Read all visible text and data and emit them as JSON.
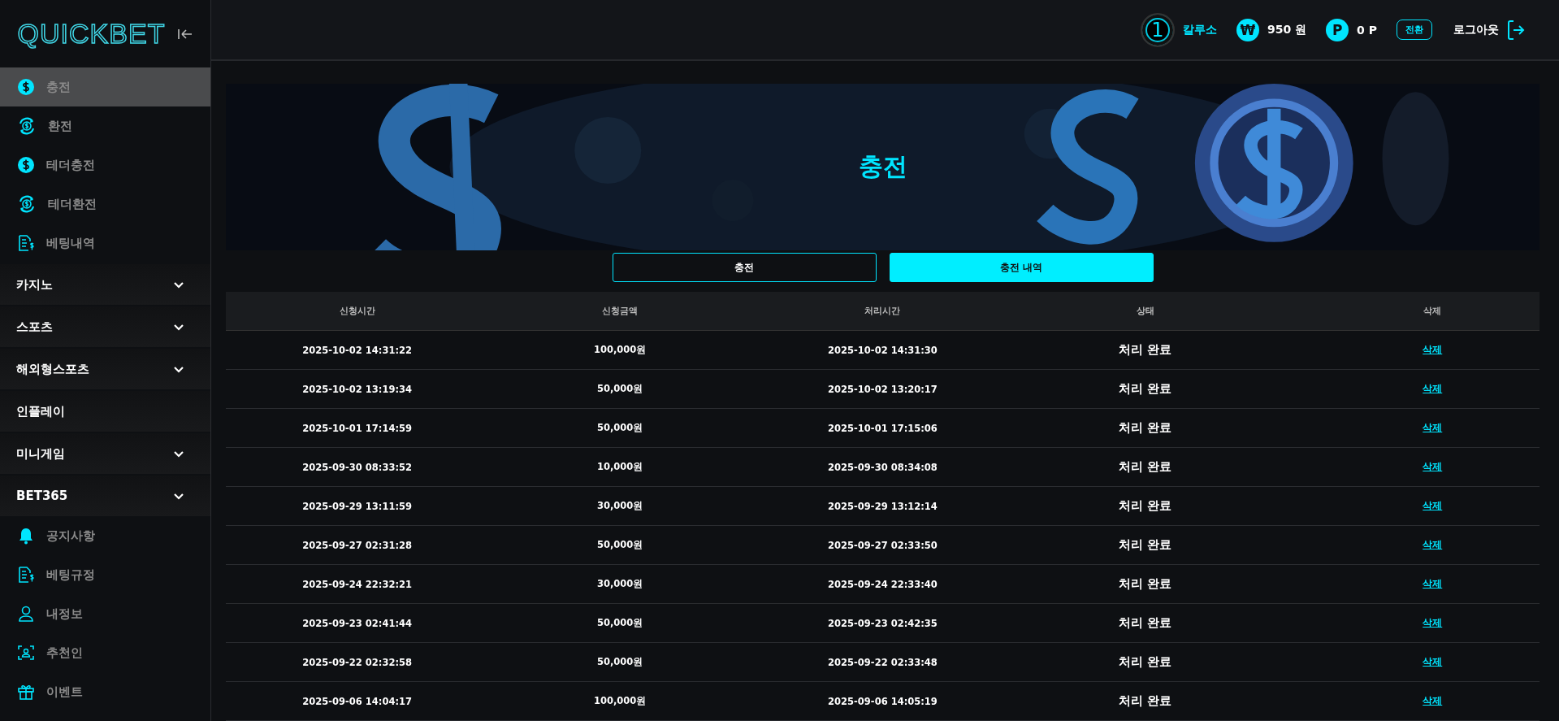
{
  "logo": "QUICKBET",
  "sidebar": {
    "top_items": [
      {
        "label": "충전",
        "kind": "coin",
        "selected": true
      },
      {
        "label": "환전",
        "kind": "exchange",
        "selected": false
      },
      {
        "label": "테더충전",
        "kind": "coin",
        "selected": false
      },
      {
        "label": "테더환전",
        "kind": "exchange",
        "selected": false
      },
      {
        "label": "베팅내역",
        "kind": "receipt",
        "selected": false
      }
    ],
    "groups": [
      {
        "label": "카지노",
        "expanded": false
      },
      {
        "label": "스포츠",
        "expanded": false
      },
      {
        "label": "해외형스포츠",
        "expanded": false
      },
      {
        "label": "인플레이"
      },
      {
        "label": "미니게임",
        "expanded": false
      },
      {
        "label": "BET365",
        "expanded": false
      }
    ],
    "bottom_items": [
      {
        "label": "공지사항",
        "kind": "bell",
        "selected": false
      },
      {
        "label": "베팅규정",
        "kind": "receipt",
        "selected": false
      },
      {
        "label": "내정보",
        "kind": "user",
        "selected": false
      },
      {
        "label": "추천인",
        "kind": "scan-user",
        "selected": false
      },
      {
        "label": "이벤트",
        "kind": "gift",
        "selected": false
      }
    ]
  },
  "header": {
    "level": "1",
    "username": "칼루소",
    "money_symbol": "₩",
    "money": "950 원",
    "point_symbol": "P",
    "points": "0 P",
    "convert_button": "전환",
    "logout": "로그아웃"
  },
  "banner": {
    "title": "충전"
  },
  "tabs": [
    {
      "label": "충전",
      "selected": false
    },
    {
      "label": "충전 내역",
      "selected": true
    }
  ],
  "table": {
    "columns": [
      "신청시간",
      "신청금액",
      "처리시간",
      "상태",
      "삭제"
    ],
    "rows": [
      {
        "requested": "2025-10-02 14:31:22",
        "amount": "100,000원",
        "processed": "2025-10-02 14:31:30",
        "status": "처리 완료",
        "action": "삭제"
      },
      {
        "requested": "2025-10-02 13:19:34",
        "amount": "50,000원",
        "processed": "2025-10-02 13:20:17",
        "status": "처리 완료",
        "action": "삭제"
      },
      {
        "requested": "2025-10-01 17:14:59",
        "amount": "50,000원",
        "processed": "2025-10-01 17:15:06",
        "status": "처리 완료",
        "action": "삭제"
      },
      {
        "requested": "2025-09-30 08:33:52",
        "amount": "10,000원",
        "processed": "2025-09-30 08:34:08",
        "status": "처리 완료",
        "action": "삭제"
      },
      {
        "requested": "2025-09-29 13:11:59",
        "amount": "30,000원",
        "processed": "2025-09-29 13:12:14",
        "status": "처리 완료",
        "action": "삭제"
      },
      {
        "requested": "2025-09-27 02:31:28",
        "amount": "50,000원",
        "processed": "2025-09-27 02:33:50",
        "status": "처리 완료",
        "action": "삭제"
      },
      {
        "requested": "2025-09-24 22:32:21",
        "amount": "30,000원",
        "processed": "2025-09-24 22:33:40",
        "status": "처리 완료",
        "action": "삭제"
      },
      {
        "requested": "2025-09-23 02:41:44",
        "amount": "50,000원",
        "processed": "2025-09-23 02:42:35",
        "status": "처리 완료",
        "action": "삭제"
      },
      {
        "requested": "2025-09-22 02:32:58",
        "amount": "50,000원",
        "processed": "2025-09-22 02:33:48",
        "status": "처리 완료",
        "action": "삭제"
      },
      {
        "requested": "2025-09-06 14:04:17",
        "amount": "100,000원",
        "processed": "2025-09-06 14:05:19",
        "status": "처리 완료",
        "action": "삭제"
      }
    ]
  }
}
